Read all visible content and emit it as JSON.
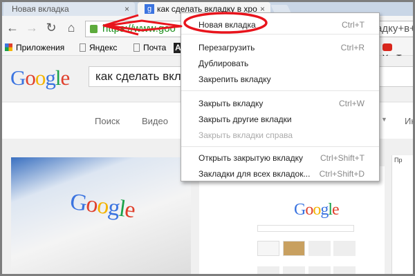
{
  "tabs": [
    {
      "title": "Новая вкладка",
      "close": "×"
    },
    {
      "title": "как сделать вкладку в хро",
      "close": "×",
      "favicon": "g"
    }
  ],
  "toolbar": {
    "url_visible": "https://www.goo",
    "url_tail": "адку+в+"
  },
  "bookmarks": [
    {
      "label": "Приложения",
      "icon": "apps-grid-icon"
    },
    {
      "label": "Яндекс",
      "icon": "page-icon"
    },
    {
      "label": "Почта",
      "icon": "page-icon"
    },
    {
      "label": "A",
      "icon": "bookmark-icon"
    },
    {
      "label": "YouT",
      "icon": "youtube-icon"
    }
  ],
  "google": {
    "logo": [
      "G",
      "o",
      "o",
      "g",
      "l",
      "e"
    ],
    "colors": [
      "#3b74e0",
      "#e0402c",
      "#f4b400",
      "#3b74e0",
      "#1aa24a",
      "#e0402c"
    ],
    "query": "как сделать вкла"
  },
  "gnav": [
    "Поиск",
    "Видео",
    "Ин"
  ],
  "panel": {
    "bookmark_label": "Пр"
  },
  "menu": {
    "items": [
      {
        "label": "Новая вкладка",
        "shortcut": "Ctrl+T"
      },
      {
        "label": "Перезагрузить",
        "shortcut": "Ctrl+R"
      },
      {
        "label": "Дублировать",
        "shortcut": ""
      },
      {
        "label": "Закрепить вкладку",
        "shortcut": ""
      },
      {
        "label": "Закрыть вкладку",
        "shortcut": "Ctrl+W"
      },
      {
        "label": "Закрыть другие вкладки",
        "shortcut": ""
      },
      {
        "label": "Закрыть вкладки справа",
        "shortcut": "",
        "disabled": true
      },
      {
        "label": "Открыть закрытую вкладку",
        "shortcut": "Ctrl+Shift+T"
      },
      {
        "label": "Закладки для всех вкладок...",
        "shortcut": "Ctrl+Shift+D"
      }
    ]
  },
  "annotation_color": "#e8141c"
}
